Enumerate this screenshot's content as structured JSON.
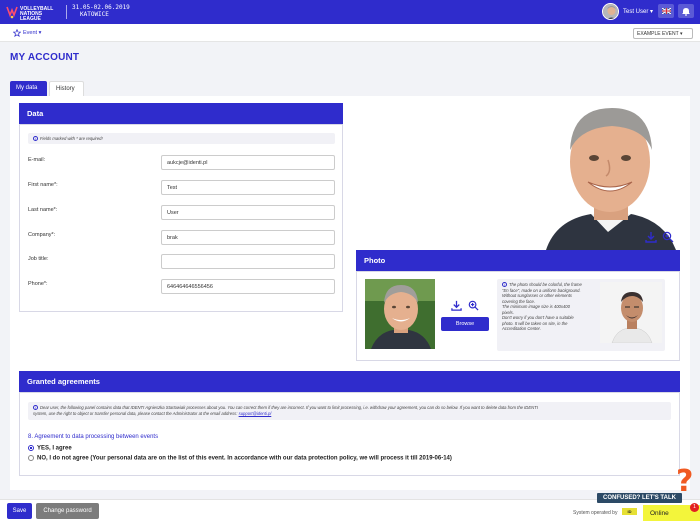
{
  "header": {
    "logo_text": "VOLLEYBALL NATIONS LEAGUE",
    "event_dates": "31.05-02.06.2019",
    "event_city": "KATOWICE",
    "user_name": "Test User ▾"
  },
  "subbar": {
    "event_menu": "Event ▾",
    "event_select": "EXAMPLE EVENT ▾"
  },
  "page": {
    "title": "MY ACCOUNT"
  },
  "tabs": [
    {
      "label": "My data",
      "active": true
    },
    {
      "label": "History",
      "active": false
    }
  ],
  "data_card": {
    "title": "Data",
    "required_note": "Fields marked with * are required!",
    "fields": [
      {
        "label": "E-mail:",
        "value": "aukcje@identi.pl"
      },
      {
        "label": "First name*:",
        "value": "Test"
      },
      {
        "label": "Last name*:",
        "value": "User"
      },
      {
        "label": "Company*:",
        "value": "brak"
      },
      {
        "label": "Job title:",
        "value": ""
      },
      {
        "label": "Phone*:",
        "value": "646464646556456"
      }
    ]
  },
  "photo_card": {
    "title": "Photo",
    "browse_label": "Browse",
    "guidance": [
      "The photo should be colorful, the frame",
      "\"En face\", made on a uniform background.",
      "Without sunglasses or other elements",
      "covering the face.",
      "The minimum image size is 400x400",
      "pixels.",
      "Don't worry if you don't have a suitable",
      "photo. It will be taken on site, in the",
      "Accreditation Center."
    ]
  },
  "agreements": {
    "title": "Granted agreements",
    "notice_1": "Dear user, the following panel contains data that IDENTI Agnieszka Startowiak processes about you. You can correct them if they are incorrect. If you want to limit processing, i.e. withdraw your agreement, you can do so below. If you want to delete data from the IDENTI",
    "notice_2": "system, use the right to object or transfer personal data, please contact the Administrator at the email address:",
    "notice_email": "support@identi.pl",
    "section_title": "8. Agreement to data processing between events",
    "option_yes": "YES, I agree",
    "option_no": "NO, I do not agree (Your personal data are on the list of this event. In accordance with our data protection policy, we will process it till 2019-06-14)"
  },
  "footer": {
    "save_label": "Save",
    "change_password_label": "Change password",
    "system_operated": "System operated by",
    "operator_logo": "ID"
  },
  "help": {
    "confused_label": "CONFUSED? LET'S TALK",
    "online_label": "Online",
    "notification_count": "1"
  },
  "colors": {
    "primary": "#2f2ccc",
    "online": "#f3f53b",
    "help_mark": "#f05a22"
  }
}
